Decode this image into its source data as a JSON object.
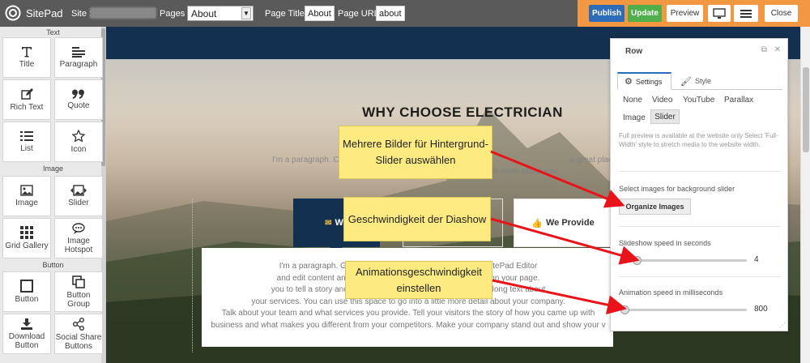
{
  "topbar": {
    "app_name": "SitePad",
    "site_label": "Site :",
    "pages_label": "Pages :",
    "pages_value": "About",
    "page_title_label": "Page Title:",
    "page_title_value": "About",
    "page_url_label": "Page URL:",
    "page_url_value": "about",
    "publish": "Publish",
    "update": "Update",
    "preview": "Preview",
    "close": "Close"
  },
  "widgets": {
    "text_section": "Text",
    "image_section": "Image",
    "button_section": "Button",
    "title": "Title",
    "paragraph": "Paragraph",
    "rich_text": "Rich Text",
    "quote": "Quote",
    "list": "List",
    "icon": "Icon",
    "image": "Image",
    "slider": "Slider",
    "grid_gallery": "Grid Gallery",
    "image_hotspot": "Image Hotspot",
    "button": "Button",
    "button_group": "Button Group",
    "download_button": "Download Button",
    "social_share": "Social Share Buttons"
  },
  "canvas": {
    "heading": "WHY CHOOSE ELECTRICIAN",
    "faded_line1": "I'm a paragraph. C",
    "faded_line1_end": "a great place for",
    "faded_line2": "to tell a story and let your users know a little more about you.",
    "tab1": "We",
    "tab3": "We Provide",
    "card_lines": [
      "I'm a paragraph. Go to SitePad Ed          easy. Just Go to SitePad Editor",
      "and edit content and make changes          nywhere you like on your page.",
      "you to tell a story and let your users           reat space to write long text about",
      "your services. You can use this space to go into a little more detail about your company.",
      "Talk about your team and what services you provide. Tell your visitors the story of how you came up with",
      "business and what makes you different from your competitors. Make your company stand out and show your v"
    ]
  },
  "row_panel": {
    "title": "Row",
    "tab_settings": "Settings",
    "tab_style": "Style",
    "opt_none": "None",
    "opt_video": "Video",
    "opt_youtube": "YouTube",
    "opt_parallax": "Parallax",
    "opt_image": "Image",
    "opt_slider": "Slider",
    "note": "Full preview is available at the website only Select 'Full-Width' style to stretch media to the website width.",
    "select_images_label": "Select images for background slider",
    "organize_button": "Organize Images",
    "slideshow_label": "Slideshow speed in seconds",
    "slideshow_value": "4",
    "slideshow_fraction": 0.1,
    "animation_label": "Animation speed in milliseconds",
    "animation_value": "800",
    "animation_fraction": 0.0
  },
  "callouts": {
    "c1": "Mehrere Bilder für Hintergrund-Slider auswählen",
    "c2": "Geschwindigkeit der Diashow",
    "c3": "Animationsgeschwindigkeit einstellen"
  },
  "colors": {
    "topbar": "#5a5a5a",
    "actions_bar": "#f29842",
    "publish": "#2d6cb8",
    "update": "#4fb04b",
    "callout": "#fdeb82",
    "arrow": "#e8141a",
    "canvas_dark": "#143050"
  }
}
